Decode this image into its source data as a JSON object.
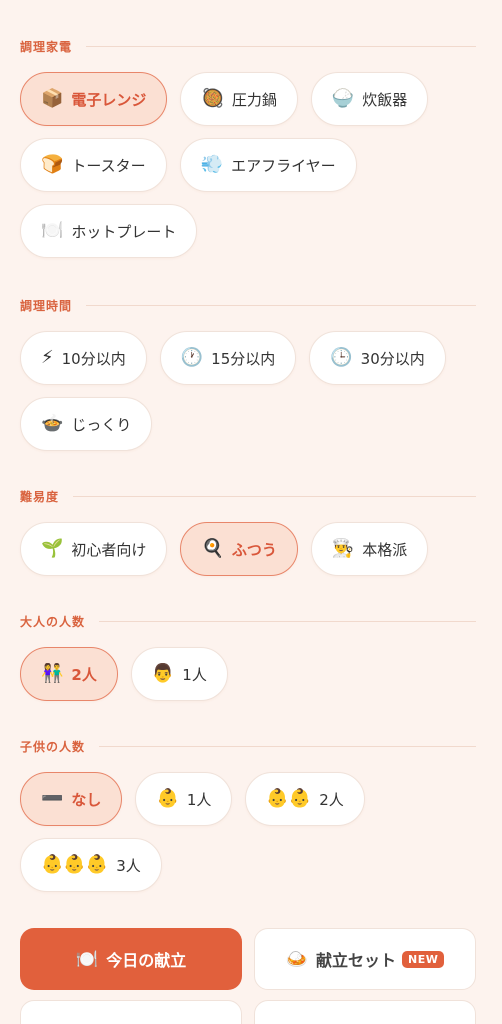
{
  "appliance": {
    "title": "調理家電",
    "options": [
      {
        "icon": "📦",
        "label": "電子レンジ",
        "selected": true
      },
      {
        "icon": "🥘",
        "label": "圧力鍋",
        "selected": false
      },
      {
        "icon": "🍚",
        "label": "炊飯器",
        "selected": false
      },
      {
        "icon": "🍞",
        "label": "トースター",
        "selected": false
      },
      {
        "icon": "💨",
        "label": "エアフライヤー",
        "selected": false
      },
      {
        "icon": "🍽️",
        "label": "ホットプレート",
        "selected": false
      }
    ]
  },
  "cook_time": {
    "title": "調理時間",
    "options": [
      {
        "icon": "⚡",
        "label": "10分以内",
        "selected": false
      },
      {
        "icon": "🕐",
        "label": "15分以内",
        "selected": false
      },
      {
        "icon": "🕒",
        "label": "30分以内",
        "selected": false
      },
      {
        "icon": "🍲",
        "label": "じっくり",
        "selected": false
      }
    ]
  },
  "difficulty": {
    "title": "難易度",
    "options": [
      {
        "icon": "🌱",
        "label": "初心者向け",
        "selected": false
      },
      {
        "icon": "🍳",
        "label": "ふつう",
        "selected": true
      },
      {
        "icon": "👨‍🍳",
        "label": "本格派",
        "selected": false
      }
    ]
  },
  "adults": {
    "title": "大人の人数",
    "options": [
      {
        "icon": "👫",
        "label": "2人",
        "selected": true
      },
      {
        "icon": "👨",
        "label": "1人",
        "selected": false
      }
    ]
  },
  "children": {
    "title": "子供の人数",
    "options": [
      {
        "icon": "➖",
        "label": "なし",
        "selected": true
      },
      {
        "icon": "👶",
        "label": "1人",
        "selected": false
      },
      {
        "icon": "👶👶",
        "label": "2人",
        "selected": false
      },
      {
        "icon": "👶👶👶",
        "label": "3人",
        "selected": false
      }
    ]
  },
  "actions": {
    "today_menu": {
      "icon": "🍽️",
      "label": "今日の献立"
    },
    "menu_set": {
      "icon": "🍛",
      "label": "献立セット",
      "badge": "NEW"
    }
  }
}
